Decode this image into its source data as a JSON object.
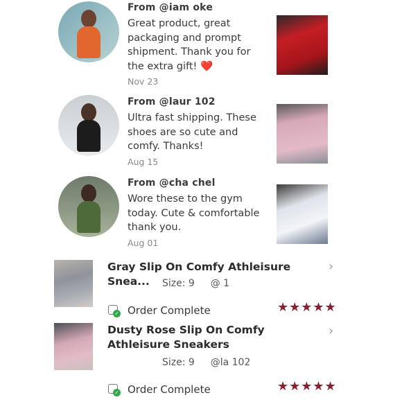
{
  "reviews": [
    {
      "from": "From @iam   oke",
      "body": "Great product, great packaging and prompt shipment. Thank you for the extra gift!",
      "emoji": "❤️",
      "date": "Nov 23",
      "photo_color": "#c41e24"
    },
    {
      "from": "From @laur    102",
      "body": "Ultra fast shipping. These shoes are so cute and comfy. Thanks!",
      "emoji": "",
      "date": "Aug 15",
      "photo_color": "#d7a9b8"
    },
    {
      "from": "From @cha    chel",
      "body": "Wore these to the gym today. Cute & comfortable thank you.",
      "emoji": "",
      "date": "Aug 01",
      "photo_color": "#dfe3ea"
    }
  ],
  "orders": [
    {
      "title": "Gray Slip On Comfy Athleisure Snea...",
      "size_label": "Size: 9",
      "user": "@   1",
      "status": "Order Complete",
      "rating": "★★★★★",
      "chevron": "›"
    },
    {
      "title": "Dusty Rose Slip On Comfy Athleisure Sneakers",
      "size_label": "Size: 9",
      "user": "@la   102",
      "status": "Order Complete",
      "rating": "★★★★★",
      "chevron": "›"
    }
  ],
  "colors": {
    "star": "#8a1f2e",
    "check": "#2fa84f"
  },
  "icons": {
    "status": "package-check-icon",
    "rating": "star-icon",
    "chevron": "chevron-right-icon"
  }
}
